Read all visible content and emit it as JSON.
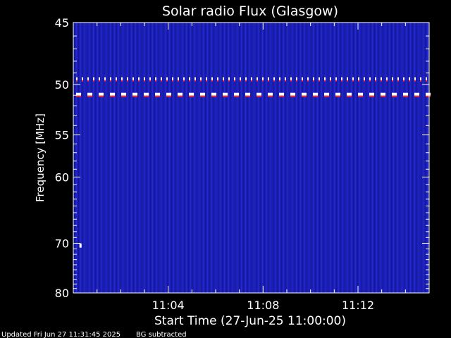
{
  "chart_data": {
    "type": "heatmap",
    "title": "Solar radio Flux (Glasgow)",
    "xlabel": "Start Time (27-Jun-25 11:00:00)",
    "ylabel": "Frequency [MHz]",
    "x_range_minutes": [
      0,
      15
    ],
    "y_range_mhz": [
      45,
      80
    ],
    "y_scale": "reciprocal",
    "xticks": [
      {
        "minute": 4,
        "label": "11:04"
      },
      {
        "minute": 8,
        "label": "11:08"
      },
      {
        "minute": 12,
        "label": "11:12"
      }
    ],
    "yticks": [
      {
        "mhz": 45,
        "label": "45"
      },
      {
        "mhz": 50,
        "label": "50"
      },
      {
        "mhz": 55,
        "label": "55"
      },
      {
        "mhz": 60,
        "label": "60"
      },
      {
        "mhz": 70,
        "label": "70"
      },
      {
        "mhz": 80,
        "label": "80"
      }
    ],
    "background_color": "#1b1fb5",
    "interference_bands_mhz": [
      {
        "mhz": 49.5,
        "color": "#ffffff",
        "pattern": "dotted"
      },
      {
        "mhz": 50.9,
        "color": "#ffffff",
        "pattern": "dashed"
      }
    ],
    "bursts": [
      {
        "minute": 0.2,
        "mhz": 70.4
      }
    ],
    "grid": false
  },
  "footer": {
    "updated": "Updated Fri Jun 27 11:31:45 2025",
    "note": "BG subtracted"
  }
}
